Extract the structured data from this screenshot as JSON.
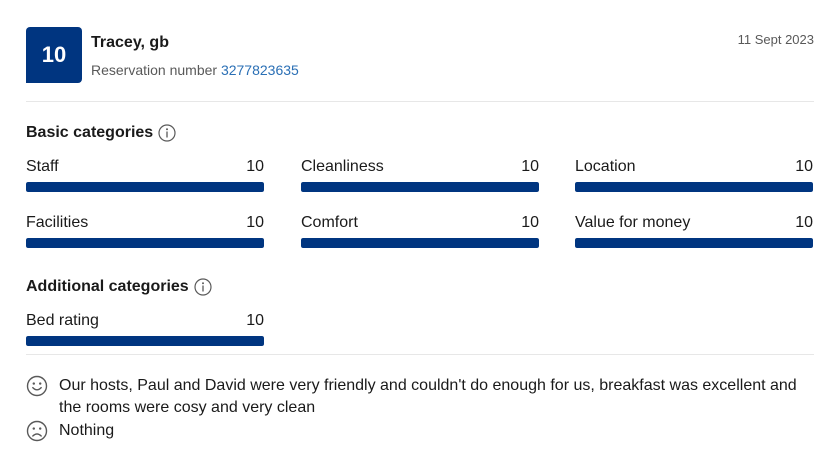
{
  "review": {
    "score": "10",
    "reviewer": "Tracey, gb",
    "reservation_label": "Reservation number",
    "reservation_number": "3277823635",
    "date": "11 Sept 2023"
  },
  "basic": {
    "title": "Basic categories",
    "items": [
      {
        "label": "Staff",
        "score": "10",
        "fill": 1.0
      },
      {
        "label": "Cleanliness",
        "score": "10",
        "fill": 1.0
      },
      {
        "label": "Location",
        "score": "10",
        "fill": 1.0
      },
      {
        "label": "Facilities",
        "score": "10",
        "fill": 1.0
      },
      {
        "label": "Comfort",
        "score": "10",
        "fill": 1.0
      },
      {
        "label": "Value for money",
        "score": "10",
        "fill": 1.0
      }
    ]
  },
  "additional": {
    "title": "Additional categories",
    "items": [
      {
        "label": "Bed rating",
        "score": "10",
        "fill": 1.0
      }
    ]
  },
  "comments": {
    "positive": "Our hosts, Paul and David were very friendly and couldn't do enough for us, breakfast was excellent and the rooms were cosy and very clean",
    "negative": "Nothing"
  },
  "colors": {
    "brand": "#003580",
    "link": "#2a6fb5"
  },
  "icons": {
    "info": "info-icon",
    "positive": "smile-icon",
    "negative": "frown-icon"
  }
}
